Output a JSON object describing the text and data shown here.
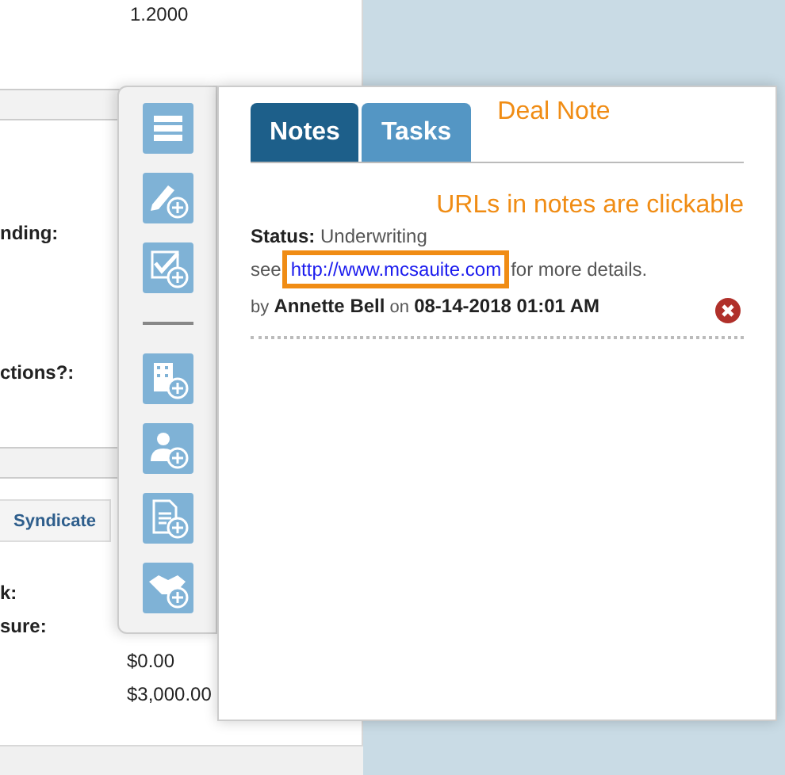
{
  "background": {
    "top_value": "1.2000",
    "labels": [
      "nding:",
      "ctions?:"
    ],
    "syndicate_button": "Syndicate",
    "lower_labels": [
      "k:",
      "sure:"
    ],
    "lower_values": [
      "$0.00",
      "$3,000.00"
    ]
  },
  "tabs": [
    {
      "label": "Notes",
      "selected": true
    },
    {
      "label": "Tasks",
      "selected": false
    }
  ],
  "header_annotation": "Deal Note",
  "note_annotation": "URLs in notes are clickable",
  "note": {
    "status_label": "Status:",
    "status": "Underwriting",
    "text_before": "see",
    "link": "http://www.mcsauite.com",
    "link_highlighted": true,
    "text_after": "for more details.",
    "by": "by",
    "author": "Annette Bell",
    "on": "on",
    "date": "08-14-2018 01:01 AM"
  }
}
